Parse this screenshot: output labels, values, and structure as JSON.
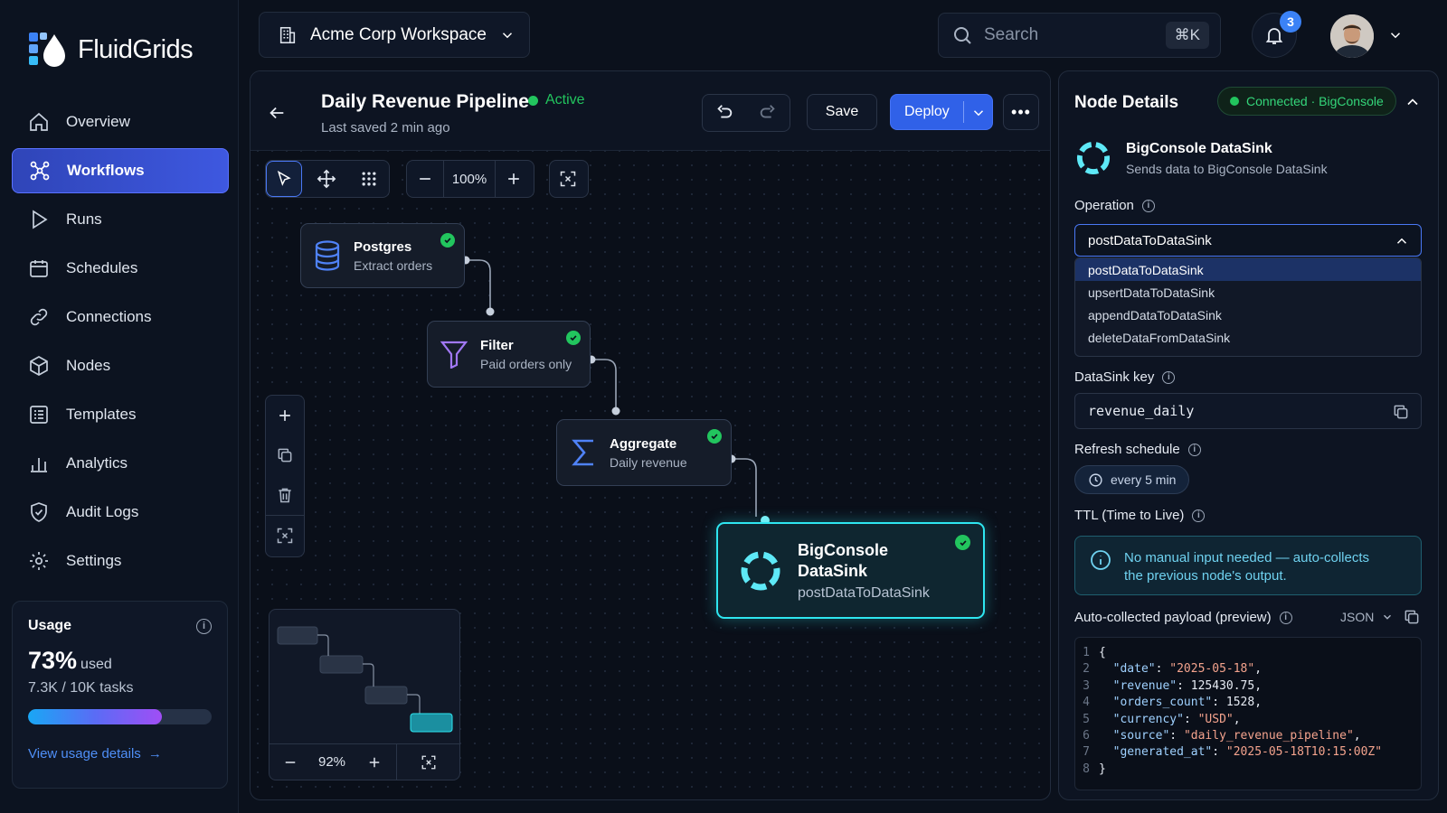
{
  "app": {
    "name": "FluidGrids"
  },
  "sidebar": {
    "items": [
      {
        "label": "Overview",
        "icon": "home-icon"
      },
      {
        "label": "Workflows",
        "icon": "workflow-icon",
        "active": true
      },
      {
        "label": "Runs",
        "icon": "play-icon"
      },
      {
        "label": "Schedules",
        "icon": "calendar-icon"
      },
      {
        "label": "Connections",
        "icon": "link-icon"
      },
      {
        "label": "Nodes",
        "icon": "cube-icon"
      },
      {
        "label": "Templates",
        "icon": "list-icon"
      },
      {
        "label": "Analytics",
        "icon": "bar-chart-icon"
      },
      {
        "label": "Audit Logs",
        "icon": "shield-icon"
      },
      {
        "label": "Settings",
        "icon": "gear-icon"
      }
    ],
    "usage": {
      "title": "Usage",
      "percent": "73%",
      "used_label": "used",
      "tasks": "7.3K / 10K tasks",
      "fill": 0.73,
      "link": "View usage details"
    }
  },
  "topbar": {
    "workspace": "Acme Corp Workspace",
    "search_placeholder": "Search",
    "shortcut": "⌘K",
    "notifications": "3"
  },
  "pipeline": {
    "title": "Daily Revenue Pipeline",
    "status": "Active",
    "saved": "Last saved 2 min ago",
    "save_label": "Save",
    "deploy_label": "Deploy",
    "zoom": "100%"
  },
  "nodes": [
    {
      "title": "Postgres",
      "subtitle": "Extract orders"
    },
    {
      "title": "Filter",
      "subtitle": "Paid orders only"
    },
    {
      "title": "Aggregate",
      "subtitle": "Daily revenue"
    },
    {
      "title": "BigConsole",
      "title2": "DataSink",
      "subtitle": "postDataToDataSink"
    }
  ],
  "minimap": {
    "zoom": "92%"
  },
  "details": {
    "heading": "Node Details",
    "connection": "Connected · BigConsole",
    "node_title": "BigConsole DataSink",
    "node_desc": "Sends data to BigConsole DataSink",
    "operation_label": "Operation",
    "operation_value": "postDataToDataSink",
    "operation_options": [
      "postDataToDataSink",
      "upsertDataToDataSink",
      "appendDataToDataSink",
      "deleteDataFromDataSink"
    ],
    "key_label": "DataSink key",
    "key_value": "revenue_daily",
    "refresh_label": "Refresh schedule",
    "refresh_value": "every 5 min",
    "ttl_label": "TTL (Time to Live)",
    "ttl_note_1": "No manual input needed — auto-collects",
    "ttl_note_2": "the previous node's output.",
    "payload_label": "Auto-collected payload (preview)",
    "format": "JSON",
    "payload_lines": [
      "{",
      "  \"date\": \"2025-05-18\",",
      "  \"revenue\": 125430.75,",
      "  \"orders_count\": 1528,",
      "  \"currency\": \"USD\",",
      "  \"source\": \"daily_revenue_pipeline\",",
      "  \"generated_at\": \"2025-05-18T10:15:00Z\"",
      "}"
    ]
  },
  "colors": {
    "accent": "#3061e8",
    "success": "#22c55e",
    "selected_node": "#2ee6f0"
  }
}
